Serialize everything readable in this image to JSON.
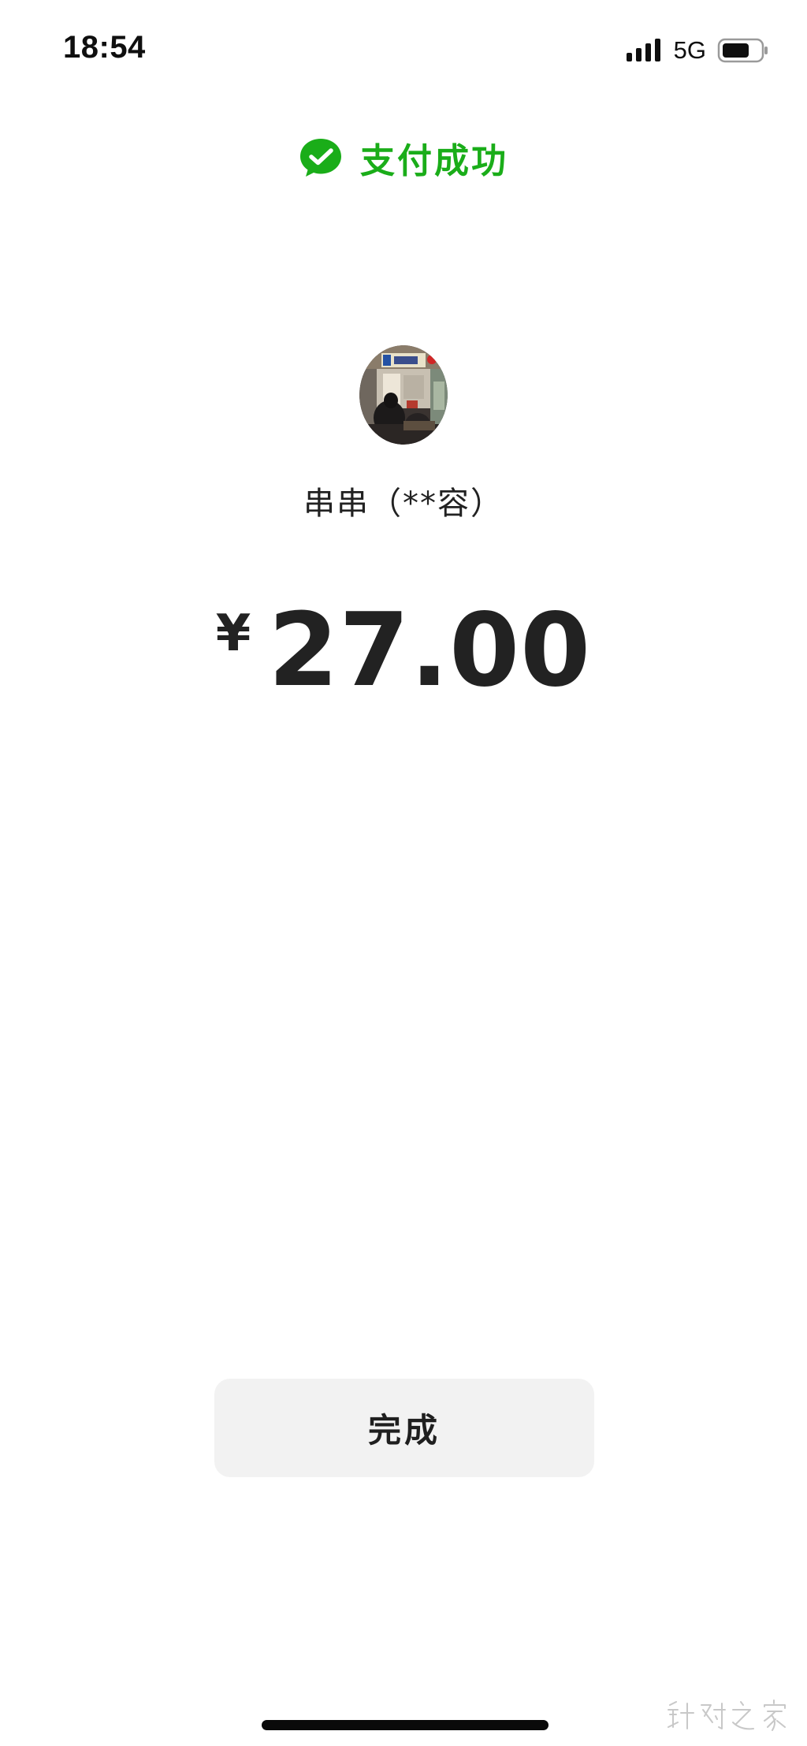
{
  "status_bar": {
    "time": "18:54",
    "network": "5G",
    "signal_icon": "signal-bars-icon",
    "battery_icon": "battery-icon"
  },
  "payment": {
    "status_text": "支付成功",
    "status_icon": "wechat-pay-check-icon",
    "status_color": "#1aad19",
    "merchant_name": "串串（**容）",
    "currency_symbol": "¥",
    "amount": "27.00"
  },
  "actions": {
    "done_label": "完成"
  },
  "watermark": {
    "text": "针对之家"
  }
}
